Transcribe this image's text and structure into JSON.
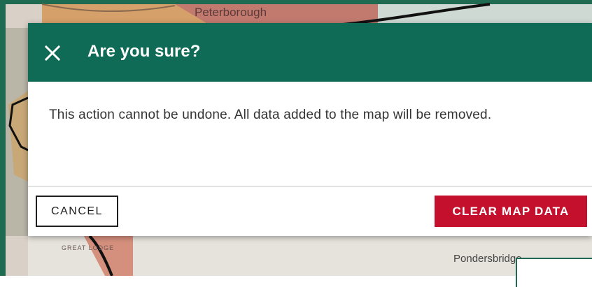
{
  "map": {
    "labels": {
      "peterborough": "Peterborough",
      "great": "GREAT LODGE",
      "pondersbridge": "Pondersbridge"
    }
  },
  "dialog": {
    "close_icon": "close-icon",
    "title": "Are you sure?",
    "message": "This action cannot be undone. All data added to the map will be removed.",
    "cancel_label": "CANCEL",
    "confirm_label": "CLEAR MAP DATA"
  },
  "colors": {
    "header": "#0f6b55",
    "confirm": "#c4102c",
    "frame": "#1c6a53"
  }
}
